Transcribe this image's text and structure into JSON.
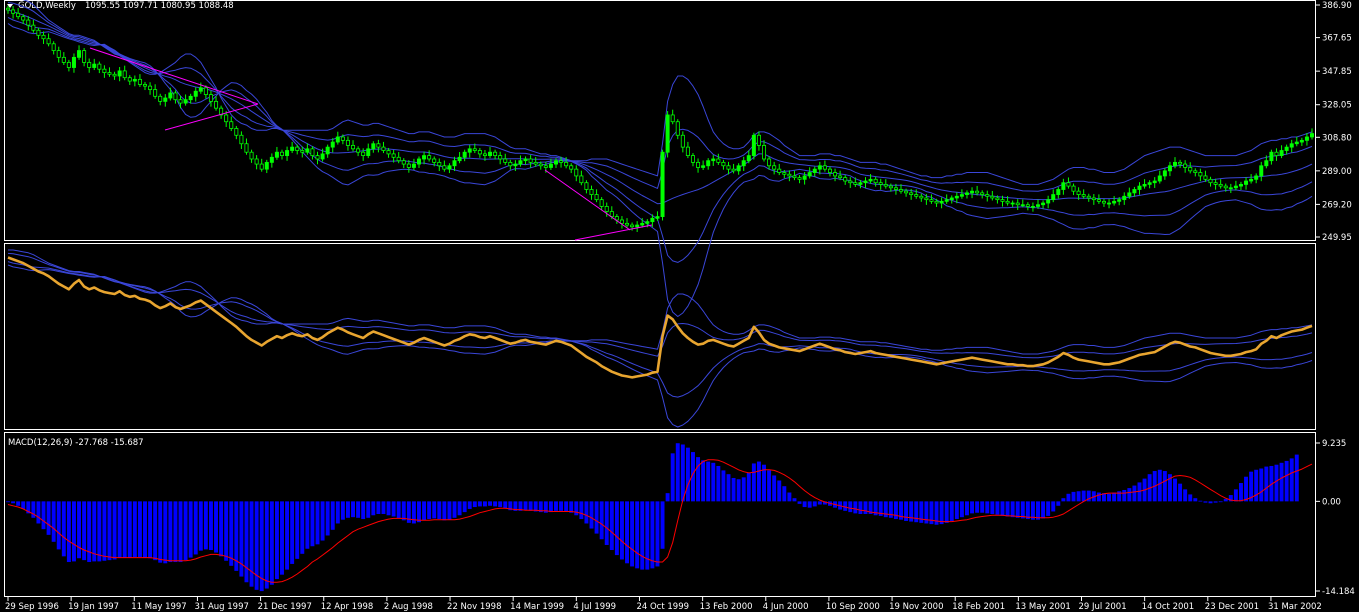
{
  "header": {
    "symbol": "GOLD,Weekly",
    "ohlc": "1095.55 1097.71 1080.95 1088.48",
    "macd_label": "MACD(12,26,9) -27.768 -15.687"
  },
  "colors": {
    "background": "#000000",
    "grid": "#ffffff",
    "candle": "#00ff00",
    "band": "#3a46d8",
    "overlay": "#e8a530",
    "macd_hist": "#0000ff",
    "signal": "#ff0000",
    "trendline": "#ff00ff"
  },
  "chart_data": [
    {
      "type": "candlestick",
      "ylim": [
        249.95,
        386.9
      ],
      "y_ticks": [
        "386.90",
        "367.65",
        "347.85",
        "328.05",
        "308.80",
        "289.00",
        "269.20",
        "249.95"
      ],
      "close": [
        384,
        382,
        380,
        378,
        375,
        372,
        369,
        367,
        364,
        360,
        356,
        353,
        350,
        356,
        360,
        353,
        350,
        352,
        349,
        347,
        346,
        345,
        348,
        344,
        342,
        343,
        340,
        339,
        337,
        333,
        330,
        332,
        335,
        331,
        329,
        331,
        333,
        336,
        338,
        334,
        330,
        326,
        322,
        318,
        314,
        310,
        305,
        300,
        296,
        293,
        290,
        294,
        297,
        300,
        298,
        301,
        303,
        301,
        300,
        302,
        298,
        296,
        299,
        303,
        306,
        309,
        307,
        304,
        302,
        300,
        298,
        302,
        305,
        303,
        301,
        299,
        297,
        295,
        293,
        291,
        293,
        296,
        298,
        296,
        294,
        292,
        290,
        292,
        295,
        297,
        300,
        302,
        301,
        299,
        298,
        300,
        298,
        296,
        294,
        292,
        293,
        295,
        296,
        294,
        293,
        292,
        291,
        293,
        295,
        294,
        292,
        290,
        286,
        282,
        278,
        275,
        272,
        268,
        265,
        262,
        260,
        258,
        257,
        256,
        257,
        258,
        259,
        261,
        262,
        300,
        322,
        318,
        310,
        303,
        298,
        294,
        291,
        292,
        295,
        296,
        294,
        292,
        290,
        289,
        292,
        295,
        298,
        310,
        304,
        296,
        292,
        290,
        288,
        287,
        286,
        285,
        284,
        286,
        288,
        290,
        292,
        290,
        288,
        286,
        285,
        283,
        282,
        281,
        282,
        283,
        284,
        282,
        281,
        280,
        279,
        278,
        277,
        276,
        275,
        274,
        273,
        272,
        271,
        270,
        271,
        272,
        273,
        274,
        275,
        276,
        277,
        276,
        275,
        274,
        273,
        272,
        271,
        270,
        270,
        269,
        269,
        268,
        268,
        269,
        270,
        272,
        275,
        278,
        282,
        280,
        277,
        275,
        274,
        273,
        272,
        271,
        270,
        270,
        271,
        272,
        274,
        276,
        278,
        280,
        281,
        282,
        283,
        286,
        289,
        292,
        294,
        293,
        291,
        289,
        288,
        286,
        284,
        282,
        281,
        280,
        279,
        279,
        280,
        281,
        283,
        284,
        286,
        292,
        295,
        300,
        298,
        301,
        303,
        305,
        306,
        307,
        309,
        311
      ],
      "upper_band": [
        392,
        392,
        391,
        390,
        389,
        387,
        384,
        381,
        378,
        376,
        374,
        372,
        370,
        369,
        369,
        368,
        367,
        366,
        364,
        362,
        360,
        358,
        357,
        355,
        353,
        351,
        349,
        347,
        346,
        346,
        347,
        349,
        351,
        353,
        356,
        358,
        358,
        356,
        353,
        348,
        343,
        338,
        332,
        327,
        322,
        319,
        317,
        316,
        314,
        313,
        313,
        313,
        314,
        314,
        313,
        313,
        313,
        313,
        313,
        313,
        313,
        313,
        313,
        313,
        314,
        316,
        318,
        319,
        318,
        317,
        316,
        316,
        317,
        317,
        316,
        315,
        314,
        313,
        312,
        311,
        311,
        312,
        312,
        312,
        311,
        310,
        309,
        309,
        309,
        310,
        311,
        311,
        311,
        311,
        311,
        310,
        309,
        307,
        305,
        303,
        302,
        302,
        302,
        301,
        300,
        299,
        299,
        298,
        298,
        297,
        296,
        295,
        295,
        295,
        295,
        296,
        296,
        296,
        296,
        295,
        294,
        293,
        292,
        291,
        290,
        289,
        288,
        287,
        286,
        305,
        330,
        340,
        345,
        345,
        343,
        339,
        334,
        327,
        319,
        312,
        308,
        305,
        303,
        302,
        302,
        303,
        306,
        310,
        312,
        312,
        311,
        309,
        307,
        304,
        302,
        300,
        298,
        298,
        298,
        298,
        299,
        299,
        299,
        298,
        298,
        297,
        296,
        295,
        294,
        294,
        294,
        294,
        293,
        293,
        292,
        291,
        290,
        289,
        288,
        287,
        286,
        286,
        285,
        285,
        285,
        286,
        286,
        287,
        287,
        288,
        288,
        288,
        288,
        288,
        287,
        286,
        285,
        284,
        283,
        282,
        281,
        281,
        281,
        281,
        282,
        283,
        284,
        286,
        288,
        290,
        291,
        291,
        291,
        290,
        290,
        289,
        288,
        288,
        288,
        289,
        290,
        292,
        294,
        296,
        298,
        299,
        300,
        301,
        302,
        303,
        303,
        303,
        302,
        301,
        300,
        299,
        298,
        298,
        298,
        298,
        298,
        298,
        298,
        299,
        300,
        301,
        303,
        305,
        306,
        307,
        307,
        308,
        308,
        309,
        309,
        310,
        311,
        312
      ]
    },
    {
      "type": "line",
      "series": []
    },
    {
      "type": "bar",
      "ylim": [
        -14.184,
        9.235
      ],
      "y_ticks": [
        "9.235",
        "0.00",
        "-14.184"
      ],
      "x_tick_labels": [
        "29 Sep 1996",
        "19 Jan 1997",
        "11 May 1997",
        "31 Aug 1997",
        "21 Dec 1997",
        "12 Apr 1998",
        "2 Aug 1998",
        "22 Nov 1998",
        "14 Mar 1999",
        "4 Jul 1999",
        "24 Oct 1999",
        "13 Feb 2000",
        "4 Jun 2000",
        "10 Sep 2000",
        "19 Nov 2000",
        "18 Feb 2001",
        "13 May 2001",
        "29 Jul 2001",
        "14 Oct 2001",
        "23 Dec 2001",
        "31 Mar 2002"
      ],
      "macd": [
        0,
        -0.3,
        -0.7,
        -1.2,
        -1.9,
        -2.6,
        -3.5,
        -4.4,
        -5.3,
        -6.4,
        -7.6,
        -8.7,
        -9.6,
        -9.5,
        -9.0,
        -9.3,
        -9.6,
        -9.5,
        -9.5,
        -9.4,
        -9.3,
        -9.2,
        -8.9,
        -8.9,
        -8.9,
        -8.8,
        -8.8,
        -8.9,
        -9.0,
        -9.3,
        -9.7,
        -9.8,
        -9.6,
        -9.6,
        -9.6,
        -9.3,
        -8.9,
        -8.4,
        -7.8,
        -7.6,
        -7.7,
        -8.1,
        -8.7,
        -9.4,
        -10.2,
        -11.0,
        -11.9,
        -12.8,
        -13.5,
        -14.0,
        -14.2,
        -13.8,
        -13.2,
        -12.3,
        -11.6,
        -10.8,
        -9.9,
        -9.1,
        -8.3,
        -7.5,
        -7.1,
        -6.8,
        -6.2,
        -5.4,
        -4.5,
        -3.5,
        -2.9,
        -2.6,
        -2.5,
        -2.6,
        -2.8,
        -2.6,
        -2.2,
        -2.0,
        -2.0,
        -2.2,
        -2.4,
        -2.7,
        -3.0,
        -3.4,
        -3.5,
        -3.3,
        -3.0,
        -2.8,
        -2.7,
        -2.8,
        -3.0,
        -2.9,
        -2.6,
        -2.2,
        -1.7,
        -1.2,
        -0.9,
        -0.8,
        -0.8,
        -0.7,
        -0.8,
        -0.9,
        -1.1,
        -1.4,
        -1.5,
        -1.5,
        -1.4,
        -1.5,
        -1.6,
        -1.7,
        -1.8,
        -1.7,
        -1.5,
        -1.5,
        -1.6,
        -1.8,
        -2.2,
        -2.8,
        -3.5,
        -4.3,
        -5.1,
        -6.0,
        -6.9,
        -7.7,
        -8.5,
        -9.2,
        -9.8,
        -10.3,
        -10.6,
        -10.8,
        -10.8,
        -10.6,
        -10.3,
        -7.5,
        1.3,
        7.6,
        9.2,
        9.0,
        8.5,
        7.8,
        7.0,
        6.5,
        6.3,
        6.1,
        5.6,
        4.9,
        4.3,
        3.7,
        3.5,
        3.8,
        4.5,
        6.0,
        6.3,
        5.8,
        4.9,
        4.1,
        3.3,
        2.4,
        1.4,
        0.5,
        -0.4,
        -0.9,
        -1.0,
        -0.8,
        -0.5,
        -0.5,
        -0.7,
        -1.0,
        -1.3,
        -1.5,
        -1.7,
        -1.9,
        -2.0,
        -2.0,
        -2.0,
        -2.2,
        -2.3,
        -2.5,
        -2.6,
        -2.8,
        -2.9,
        -3.1,
        -3.2,
        -3.3,
        -3.4,
        -3.5,
        -3.6,
        -3.7,
        -3.6,
        -3.4,
        -3.1,
        -2.8,
        -2.5,
        -2.2,
        -1.9,
        -1.8,
        -1.8,
        -1.9,
        -2.0,
        -2.1,
        -2.3,
        -2.4,
        -2.5,
        -2.6,
        -2.7,
        -2.8,
        -2.9,
        -2.9,
        -2.7,
        -2.3,
        -1.6,
        -0.7,
        0.5,
        1.2,
        1.5,
        1.6,
        1.7,
        1.7,
        1.6,
        1.4,
        1.3,
        1.2,
        1.4,
        1.6,
        1.8,
        2.1,
        2.5,
        3.0,
        3.6,
        4.3,
        4.8,
        5.0,
        4.8,
        4.3,
        3.6,
        2.8,
        1.9,
        1.1,
        0.5,
        0.1,
        -0.2,
        -0.3,
        -0.2,
        0.0,
        0.4,
        1.0,
        1.9,
        2.9,
        3.9,
        4.7,
        5.0,
        5.2,
        5.5,
        5.6,
        5.8,
        6.1,
        6.4,
        6.8,
        7.4
      ],
      "signal": [
        -0.5,
        -0.7,
        -0.9,
        -1.2,
        -1.6,
        -2.0,
        -2.5,
        -3.1,
        -3.7,
        -4.3,
        -5.0,
        -5.7,
        -6.3,
        -6.8,
        -7.3,
        -7.7,
        -8.0,
        -8.3,
        -8.5,
        -8.7,
        -8.8,
        -8.9,
        -8.9,
        -8.9,
        -8.9,
        -8.9,
        -8.9,
        -8.9,
        -8.9,
        -9.0,
        -9.2,
        -9.3,
        -9.4,
        -9.4,
        -9.4,
        -9.4,
        -9.3,
        -9.1,
        -8.8,
        -8.6,
        -8.4,
        -8.4,
        -8.5,
        -8.7,
        -9.0,
        -9.4,
        -9.9,
        -10.5,
        -11.1,
        -11.7,
        -12.2,
        -12.6,
        -12.8,
        -12.8,
        -12.7,
        -12.4,
        -12.0,
        -11.5,
        -10.9,
        -10.3,
        -9.6,
        -9.1,
        -8.5,
        -7.9,
        -7.3,
        -6.6,
        -6.0,
        -5.4,
        -4.8,
        -4.4,
        -4.1,
        -3.8,
        -3.5,
        -3.2,
        -3.0,
        -2.8,
        -2.7,
        -2.7,
        -2.7,
        -2.8,
        -2.9,
        -3.0,
        -3.0,
        -3.0,
        -2.9,
        -2.9,
        -2.9,
        -2.9,
        -2.9,
        -2.8,
        -2.6,
        -2.4,
        -2.1,
        -1.8,
        -1.6,
        -1.4,
        -1.2,
        -1.1,
        -1.1,
        -1.2,
        -1.3,
        -1.3,
        -1.4,
        -1.4,
        -1.4,
        -1.5,
        -1.5,
        -1.6,
        -1.6,
        -1.6,
        -1.6,
        -1.6,
        -1.7,
        -1.9,
        -2.2,
        -2.6,
        -3.1,
        -3.6,
        -4.2,
        -4.9,
        -5.6,
        -6.3,
        -7.0,
        -7.6,
        -8.2,
        -8.7,
        -9.1,
        -9.4,
        -9.6,
        -9.6,
        -8.8,
        -6.5,
        -3.0,
        0.2,
        2.6,
        4.4,
        5.6,
        6.3,
        6.6,
        6.6,
        6.5,
        6.2,
        5.8,
        5.4,
        5.0,
        4.7,
        4.5,
        4.6,
        4.8,
        5.0,
        5.0,
        4.9,
        4.6,
        4.2,
        3.7,
        3.1,
        2.4,
        1.7,
        1.1,
        0.6,
        0.2,
        -0.1,
        -0.3,
        -0.5,
        -0.7,
        -0.9,
        -1.1,
        -1.2,
        -1.4,
        -1.5,
        -1.7,
        -1.8,
        -1.9,
        -2.0,
        -2.1,
        -2.2,
        -2.4,
        -2.5,
        -2.6,
        -2.7,
        -2.8,
        -2.9,
        -3.0,
        -3.1,
        -3.2,
        -3.2,
        -3.2,
        -3.1,
        -3.0,
        -2.9,
        -2.7,
        -2.5,
        -2.4,
        -2.3,
        -2.2,
        -2.2,
        -2.2,
        -2.3,
        -2.3,
        -2.4,
        -2.4,
        -2.5,
        -2.5,
        -2.6,
        -2.6,
        -2.6,
        -2.5,
        -2.3,
        -2.0,
        -1.5,
        -1.0,
        -0.5,
        0.0,
        0.4,
        0.7,
        1.0,
        1.2,
        1.3,
        1.3,
        1.3,
        1.3,
        1.4,
        1.5,
        1.6,
        1.8,
        2.1,
        2.4,
        2.8,
        3.2,
        3.6,
        4.0,
        4.1,
        4.0,
        3.8,
        3.4,
        2.9,
        2.4,
        1.9,
        1.4,
        0.9,
        0.5,
        0.2,
        0.1,
        0.1,
        0.3,
        0.6,
        1.0,
        1.5,
        2.1,
        2.7,
        3.2,
        3.7,
        4.1,
        4.5,
        4.8,
        5.1,
        5.5,
        5.9
      ]
    }
  ]
}
